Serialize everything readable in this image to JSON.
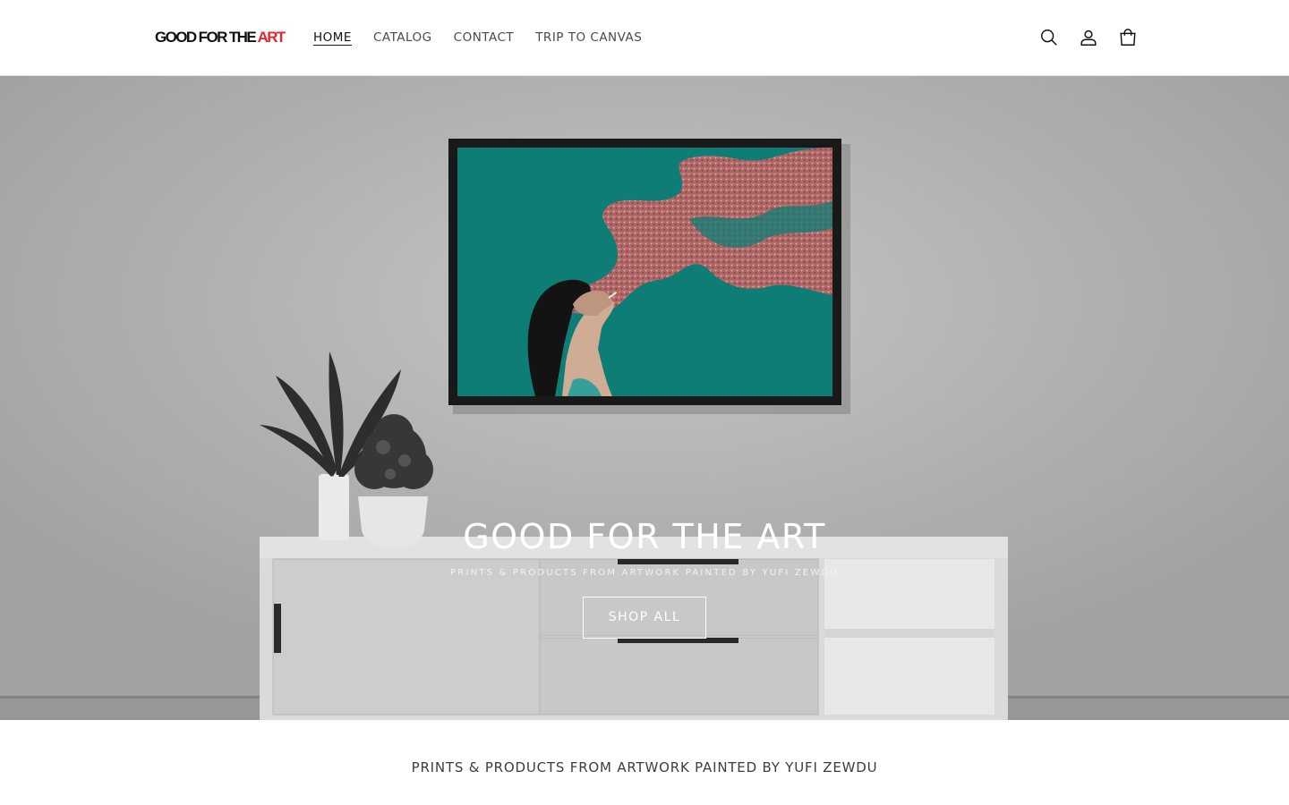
{
  "header": {
    "logo": {
      "part1": "GOOD FOR THE ",
      "part2": "ART"
    },
    "nav": [
      {
        "label": "HOME",
        "active": true
      },
      {
        "label": "CATALOG",
        "active": false
      },
      {
        "label": "CONTACT",
        "active": false
      },
      {
        "label": "TRIP TO CANVAS",
        "active": false
      }
    ],
    "icons": [
      "search-icon",
      "account-icon",
      "cart-icon"
    ]
  },
  "hero": {
    "title": "GOOD FOR THE ART",
    "subtitle": "PRINTS & PRODUCTS FROM ARTWORK PAINTED BY YUFI ZEWDU",
    "button": "SHOP ALL"
  },
  "main": {
    "tagline": "PRINTS & PRODUCTS FROM ARTWORK PAINTED BY YUFI ZEWDU"
  },
  "colors": {
    "logo_accent": "#e3262c",
    "painting_teal": "#0f837b",
    "text": "#121212"
  }
}
